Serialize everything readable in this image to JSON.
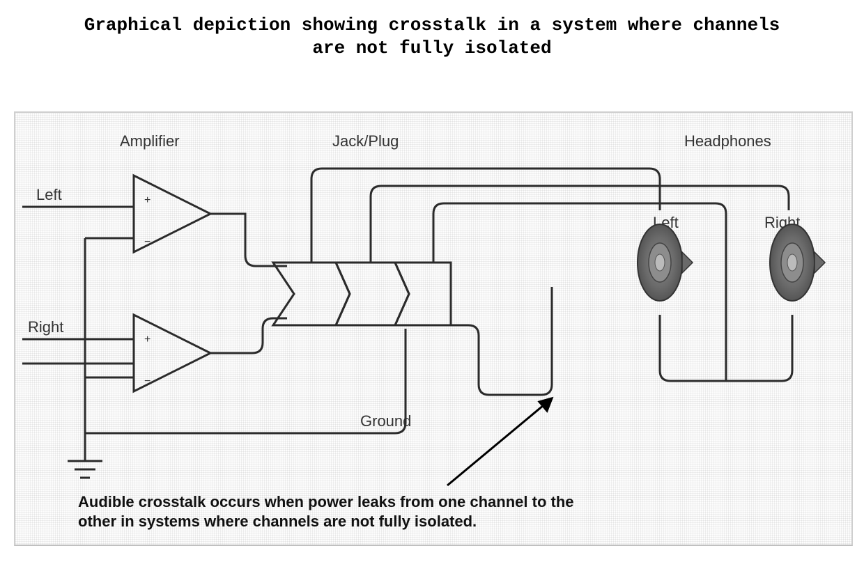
{
  "title": "Graphical depiction showing crosstalk in a system where channels\nare not fully isolated",
  "sections": {
    "amplifier": "Amplifier",
    "jackplug": "Jack/Plug",
    "headphones": "Headphones"
  },
  "signals": {
    "left_in": "Left",
    "right_in": "Right",
    "ground": "Ground",
    "left_speaker": "Left",
    "right_speaker": "Right"
  },
  "ampSymbols": {
    "plus": "+",
    "minus": "−"
  },
  "caption": "Audible crosstalk occurs when power leaks from one channel to the other in systems where channels are not fully isolated.",
  "colors": {
    "line": "#2b2b2b",
    "section": "#444444",
    "signal": "#2b2b2b",
    "speaker": "#666666"
  }
}
